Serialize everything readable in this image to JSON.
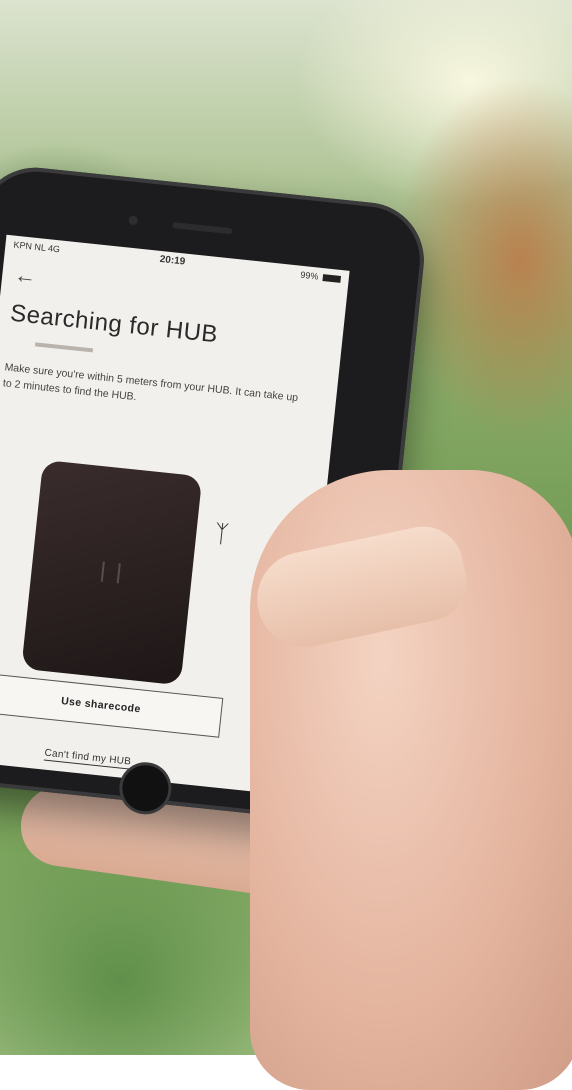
{
  "status_bar": {
    "carrier": "KPN NL 4G",
    "time": "20:19",
    "battery": "99%"
  },
  "app": {
    "title": "Searching for HUB",
    "description": "Make sure you're within 5 meters from your HUB. It can take up to 2 minutes to find the HUB.",
    "primary_button": "Use sharecode",
    "secondary_link": "Can't find my HUB",
    "icons": {
      "back": "back-arrow-icon",
      "bluetooth": "bluetooth-icon"
    }
  },
  "colors": {
    "screen_bg": "#f2f0ec",
    "hub_device": "#2b2020",
    "phone_body": "#1c1c1e"
  }
}
